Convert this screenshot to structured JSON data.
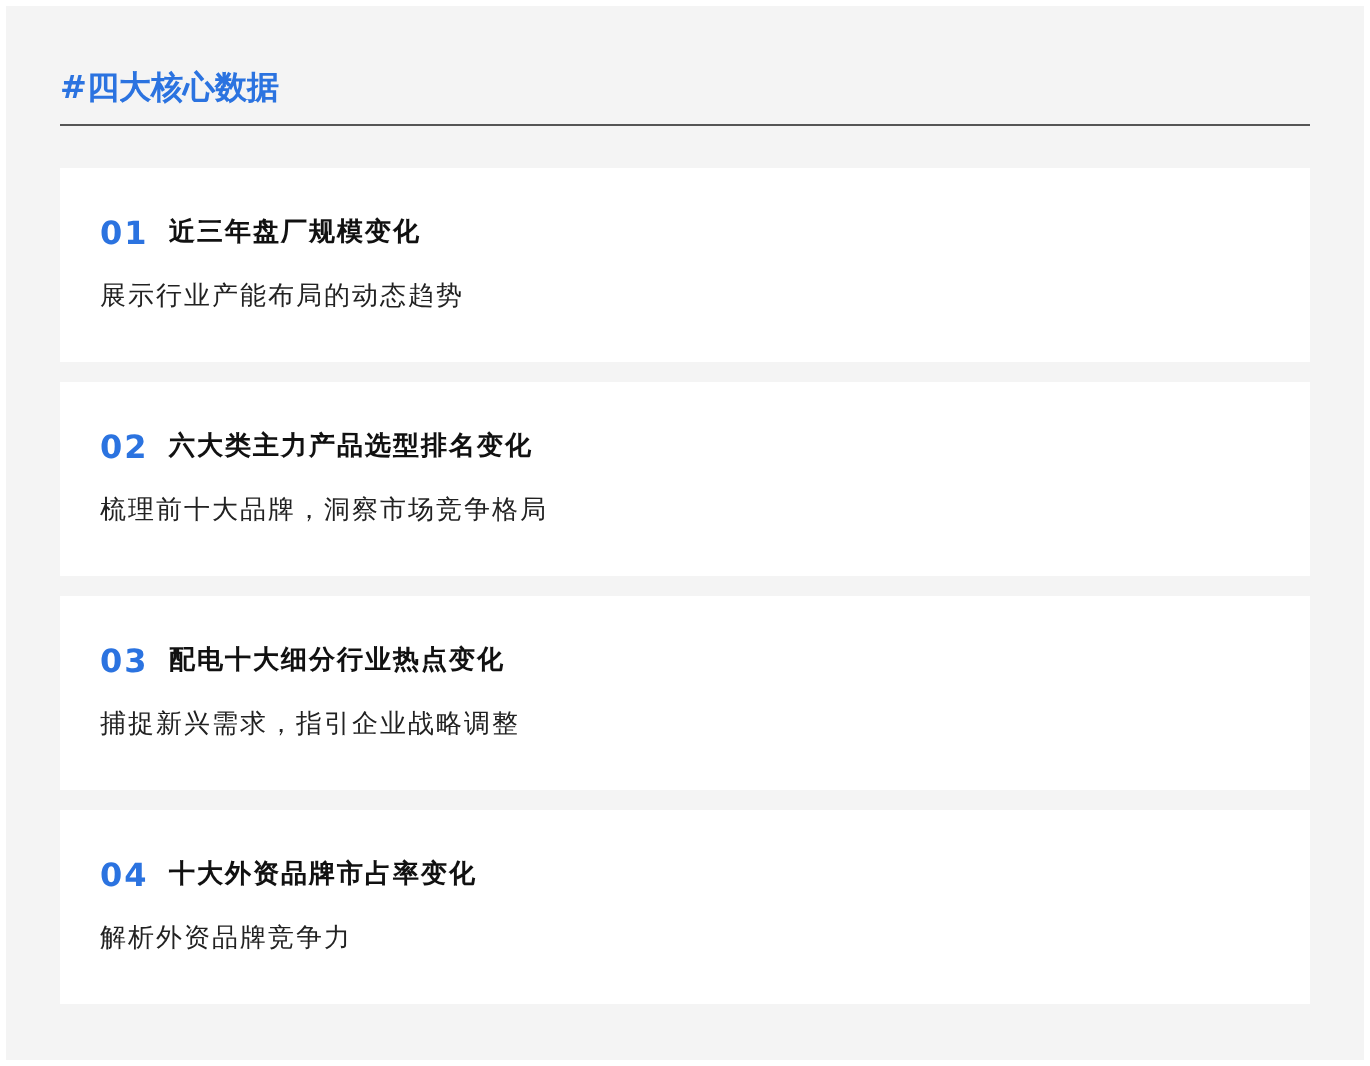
{
  "heading": "#四大核心数据",
  "cards": [
    {
      "number": "01",
      "title": "近三年盘厂规模变化",
      "description": "展示行业产能布局的动态趋势"
    },
    {
      "number": "02",
      "title": "六大类主力产品选型排名变化",
      "description": "梳理前十大品牌，洞察市场竞争格局"
    },
    {
      "number": "03",
      "title": "配电十大细分行业热点变化",
      "description": "捕捉新兴需求，指引企业战略调整"
    },
    {
      "number": "04",
      "title": "十大外资品牌市占率变化",
      "description": "解析外资品牌竞争力"
    }
  ]
}
